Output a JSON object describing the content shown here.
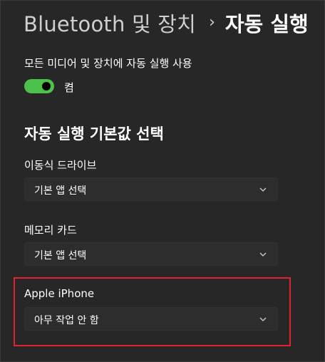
{
  "breadcrumb": {
    "parent": "Bluetooth 및 장치",
    "separator": "›",
    "current": "자동 실행"
  },
  "autoplay_toggle": {
    "label": "모든 미디어 및 장치에 자동 실행 사용",
    "state_label": "켬",
    "on": true,
    "color": "#4cc24a"
  },
  "defaults_section": {
    "title": "자동 실행 기본값 선택",
    "items": [
      {
        "label": "이동식 드라이브",
        "selected": "기본 앱 선택"
      },
      {
        "label": "메모리 카드",
        "selected": "기본 앱 선택"
      },
      {
        "label": "Apple iPhone",
        "selected": "아무 작업 안 함"
      }
    ]
  },
  "highlight_color": "#e0242f"
}
